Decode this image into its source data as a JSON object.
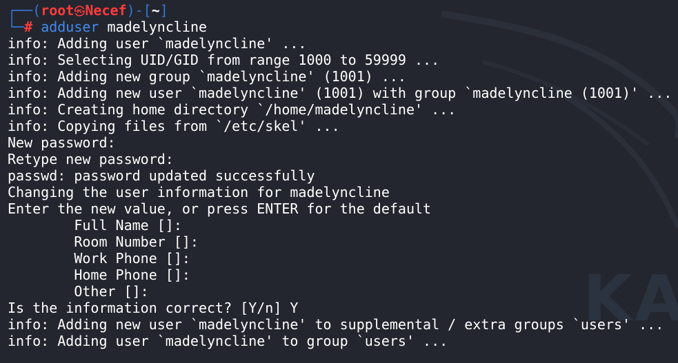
{
  "prompt": {
    "frame_top_left": "┌──(",
    "user": "root",
    "skull": "㉿",
    "host": "Necef",
    "frame_mid": ")-[",
    "cwd": "~",
    "frame_close": "]",
    "frame_bottom_left": "└─",
    "hash": "#",
    "command": "adduser",
    "argument": "madelyncline"
  },
  "output": [
    "info: Adding user `madelyncline' ...",
    "info: Selecting UID/GID from range 1000 to 59999 ...",
    "info: Adding new group `madelyncline' (1001) ...",
    "info: Adding new user `madelyncline' (1001) with group `madelyncline (1001)' ...",
    "info: Creating home directory `/home/madelyncline' ...",
    "info: Copying files from `/etc/skel' ...",
    "New password:",
    "Retype new password:",
    "passwd: password updated successfully",
    "Changing the user information for madelyncline",
    "Enter the new value, or press ENTER for the default",
    "        Full Name []:",
    "        Room Number []:",
    "        Work Phone []:",
    "        Home Phone []:",
    "        Other []:",
    "Is the information correct? [Y/n] Y",
    "info: Adding new user `madelyncline' to supplemental / extra groups `users' ...",
    "info: Adding user `madelyncline' to group `users' ..."
  ],
  "background_watermark": "KA",
  "colors": {
    "background": "#23262e",
    "frame": "#3476d6",
    "user": "#ff3b3b",
    "command": "#3f8cf0",
    "text": "#ffffff"
  }
}
